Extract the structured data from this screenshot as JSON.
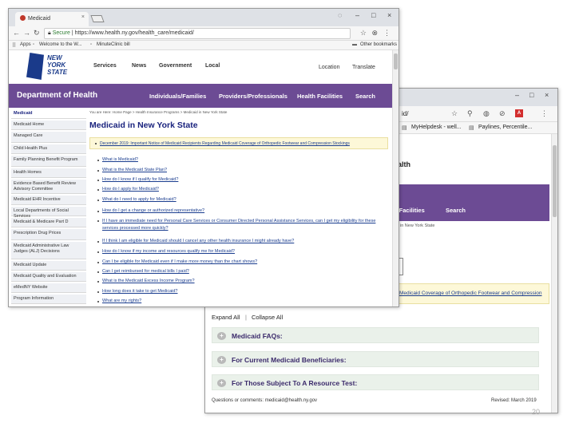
{
  "front": {
    "tab_title": "Medicaid",
    "tab_close": "×",
    "url_secure": "Secure",
    "url": "https://www.health.ny.gov/health_care/medicaid/",
    "bookmarks": {
      "apps": "Apps",
      "b1": "Welcome to the W...",
      "b2": "MinuteClinic bill",
      "other": "Other bookmarks"
    },
    "top_nav": [
      "Services",
      "News",
      "Government",
      "Local"
    ],
    "top_right": [
      "Location",
      "Translate"
    ],
    "logo": {
      "line1": "NEW",
      "line2": "YORK",
      "line3": "STATE"
    },
    "dept_title": "Department of Health",
    "main_nav": [
      "Individuals/Families",
      "Providers/Professionals",
      "Health Facilities",
      "Search"
    ],
    "breadcrumb": "You are Here: Home Page > Health Insurance Programs > Medicaid in New York State",
    "sidebar": [
      "Medicaid",
      "Medicaid Home",
      "Managed Care",
      "Child Health Plus",
      "Family Planning Benefit Program",
      "Health Homes",
      "Evidence Based Benefit Review Advisory Committee",
      "Medicaid EHR Incentive",
      "Local Departments of Social Services",
      "Medicaid & Medicare Part D",
      "Prescription Drug Prices",
      "Medicaid Administrative Law Judges (ALJ) Decisions",
      "Medicaid Update",
      "Medicaid Quality and Evaluation",
      "eMedNY Website",
      "Program Information"
    ],
    "page_title": "Medicaid in New York State",
    "notice": "December 2019: Important Notice of Medicaid Recipients Regarding Medicaid Coverage of Orthopedic Footwear and Compression Stockings",
    "links": [
      "What is Medicaid?",
      "What is the Medicaid State Plan?",
      "How do I know if I qualify for Medicaid?",
      "How do I apply for Medicaid?",
      "What do I need to apply for Medicaid?",
      "How do I get a change or authorized representative?",
      "If I have an immediate need for Personal Care Services or Consumer Directed Personal Assistance Services, can I get my eligibility for these services processed more quickly?",
      "If I think I am eligible for Medicaid should I cancel any other health insurance I might already have?",
      "How do I know if my income and resources qualify me for Medicaid?",
      "Can I be eligible for Medicaid even if I make more money than the chart shows?",
      "Can I get reimbursed for medical bills I paid?",
      "What is the Medicaid Excess Income Program?",
      "How long does it take to get Medicaid?",
      "What are my rights?"
    ]
  },
  "back": {
    "url_tail": "id/",
    "bookmarks": [
      "MyHelpdesk - well...",
      "Paylines, Percentile..."
    ],
    "dept_fragment": "ealth",
    "nav_fragment": [
      "h Facilities",
      "Search"
    ],
    "breadcrumb_fragment": "in New York State",
    "notice_fragment": "Medicaid Coverage of Orthopedic Footwear and Compression",
    "expand": "Expand All",
    "sep": "|",
    "collapse": "Collapse All",
    "faqs": [
      "Medicaid FAQs:",
      "For Current Medicaid Beneficiaries:",
      "For Those Subject To A Resource Test:"
    ],
    "footer_left": "Questions or comments: medicaid@health.ny.gov",
    "footer_right": "Revised: March 2019"
  },
  "slide_number": "20",
  "colors": {
    "purple": "#6c4b94",
    "link": "#1a3d8f",
    "notice_bg": "#fdf8d8",
    "faq_bg": "#eaf1ea"
  }
}
